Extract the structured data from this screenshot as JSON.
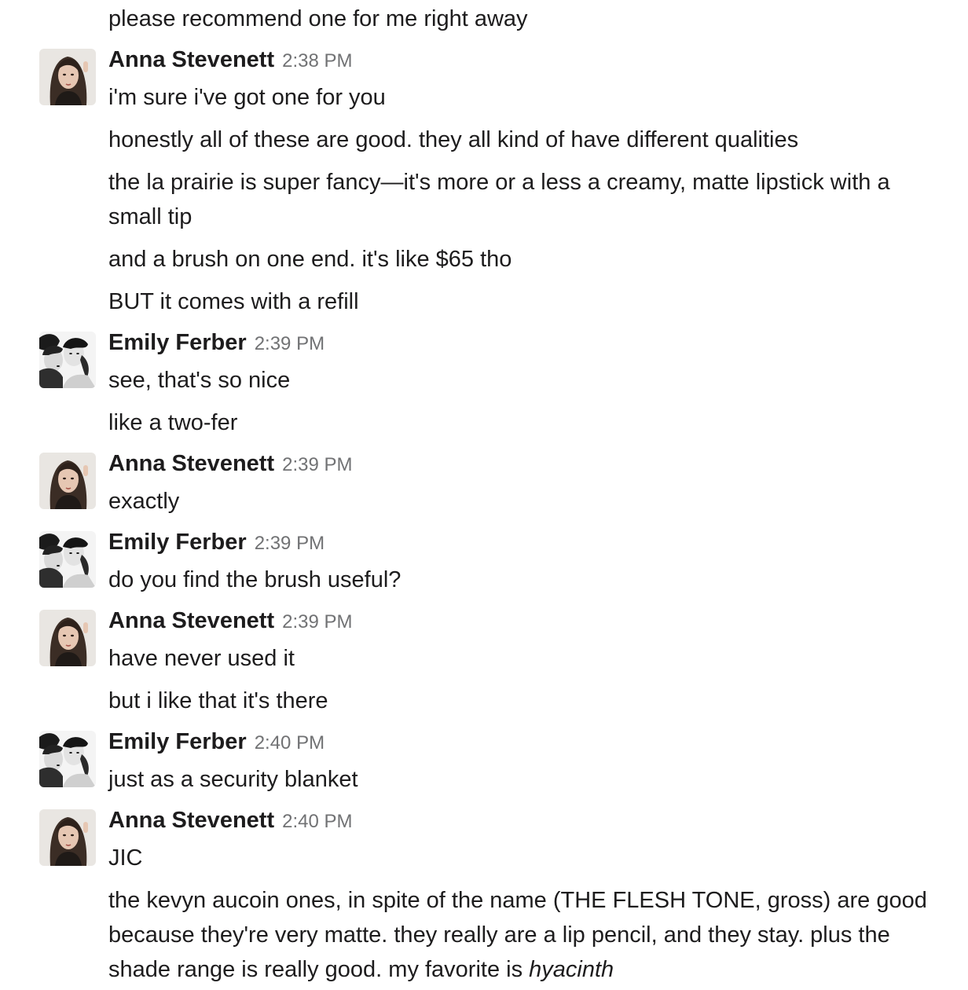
{
  "messages": {
    "m0": {
      "text": "please recommend one for me right away"
    },
    "g1": {
      "author": "Anna Stevenett",
      "time": "2:38 PM",
      "lines": [
        "i'm sure i've got one for you",
        "honestly all of these are good. they all kind of have different qualities",
        "the la prairie is super fancy—it's more or a less a creamy, matte lipstick with a small tip",
        "and a brush on one end. it's like $65 tho",
        "BUT it comes with a refill"
      ]
    },
    "g2": {
      "author": "Emily Ferber",
      "time": "2:39 PM",
      "lines": [
        "see, that's so nice",
        "like a two-fer"
      ]
    },
    "g3": {
      "author": "Anna Stevenett",
      "time": "2:39 PM",
      "lines": [
        "exactly"
      ]
    },
    "g4": {
      "author": "Emily Ferber",
      "time": "2:39 PM",
      "lines": [
        "do you find the brush useful?"
      ]
    },
    "g5": {
      "author": "Anna Stevenett",
      "time": "2:39 PM",
      "lines": [
        "have never used it",
        "but i like that it's there"
      ]
    },
    "g6": {
      "author": "Emily Ferber",
      "time": "2:40 PM",
      "lines": [
        "just as a security blanket"
      ]
    },
    "g7": {
      "author": "Anna Stevenett",
      "time": "2:40 PM",
      "lines": [
        "JIC"
      ],
      "long_text": "the kevyn aucoin ones, in spite of the name (THE FLESH TONE, gross) are good because they're very matte. they really are a lip pencil, and they stay. plus the shade range is really good. my favorite is",
      "long_text_italic": "hyacinth"
    }
  },
  "icons": {
    "anna_avatar": "person-photo-avatar",
    "emily_avatar": "group-photo-avatar"
  }
}
